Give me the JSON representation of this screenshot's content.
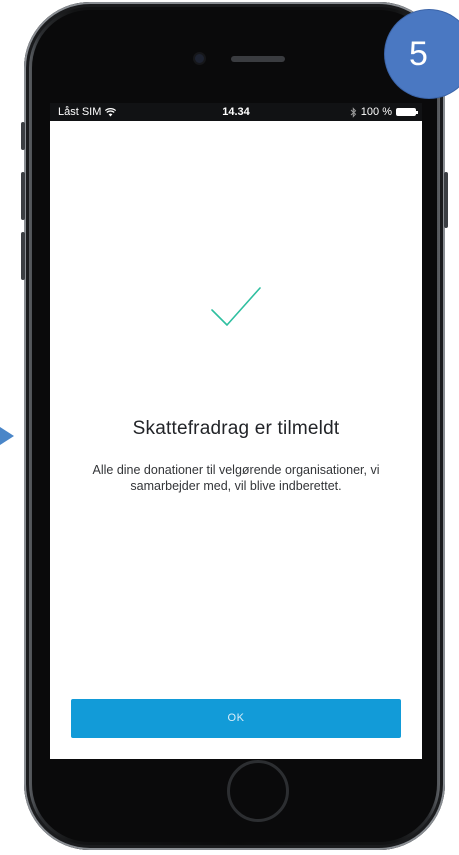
{
  "status_bar": {
    "carrier": "Låst SIM",
    "time": "14.34",
    "battery": "100 %"
  },
  "confirmation": {
    "title": "Skattefradrag er tilmeldt",
    "message": "Alle dine donationer til velgørende organisationer, vi samarbejder med, vil blive indberettet.",
    "ok_label": "OK"
  },
  "step_badge": "5",
  "colors": {
    "accent": "#129bd8",
    "check": "#2fbfa0",
    "badge": "#4a78c2"
  },
  "icons": [
    "wifi-icon",
    "bluetooth-icon",
    "battery-icon",
    "checkmark-icon",
    "arrow-right-icon"
  ]
}
